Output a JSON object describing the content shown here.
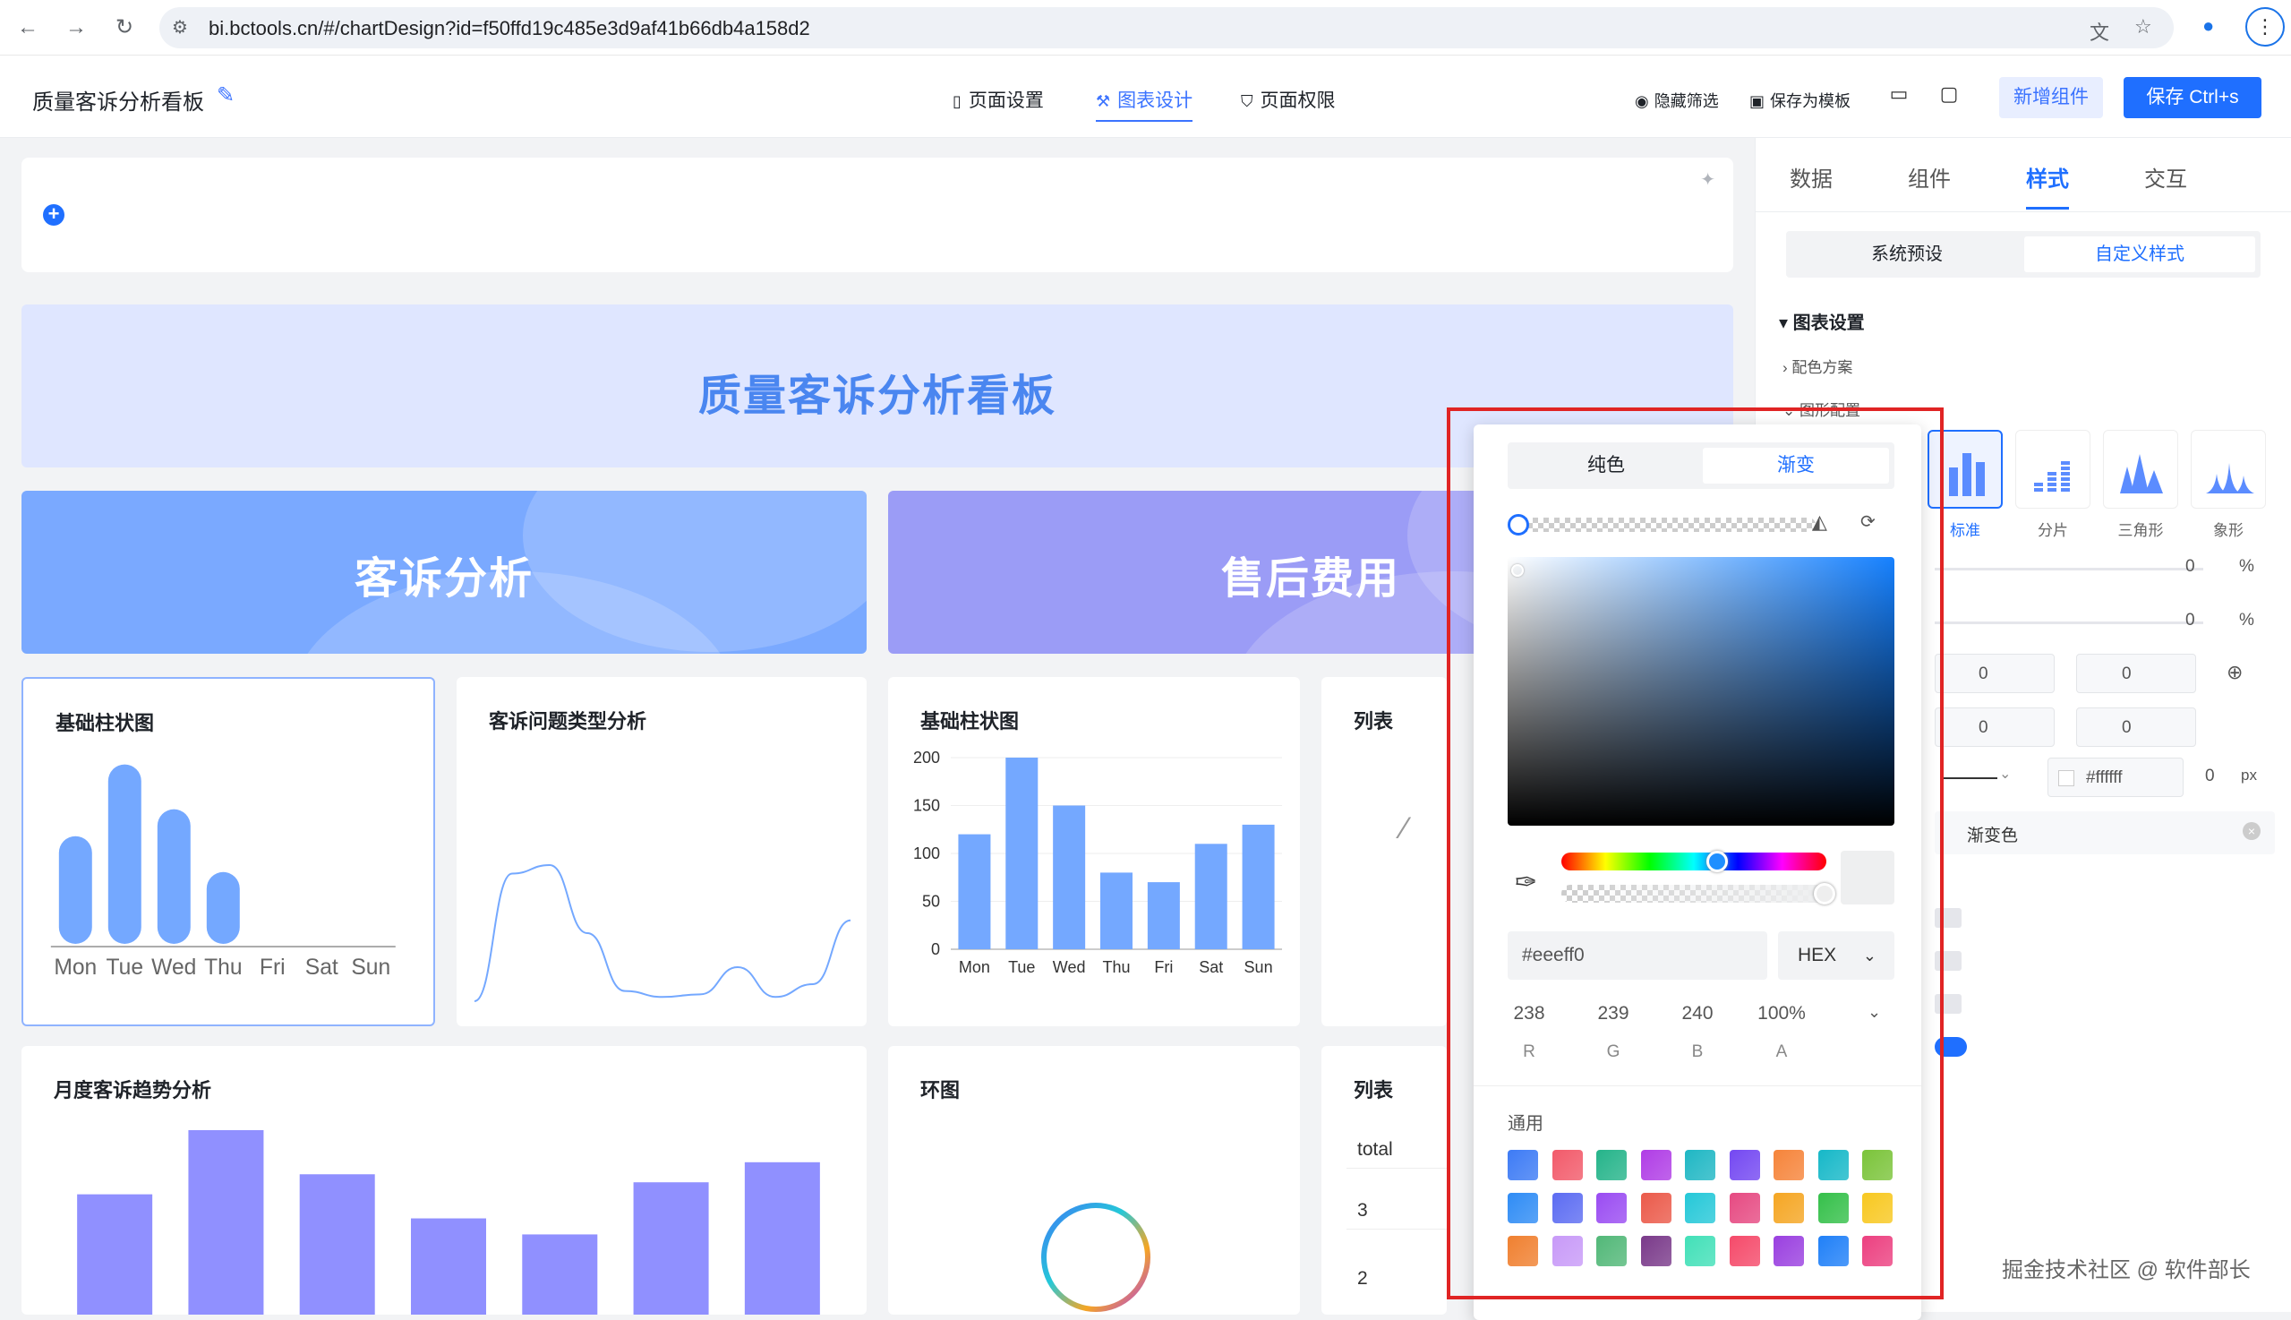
{
  "browser": {
    "url": "bi.bctools.cn/#/chartDesign?id=f50ffd19c485e3d9af41b66db4a158d2"
  },
  "header": {
    "title": "质量客诉分析看板",
    "tabs": [
      {
        "label": "页面设置"
      },
      {
        "label": "图表设计"
      },
      {
        "label": "页面权限"
      }
    ],
    "hide_filter": "隐藏筛选",
    "save_template": "保存为模板",
    "add_component": "新增组件",
    "save": "保存 Ctrl+s"
  },
  "canvas": {
    "banner_title": "质量客诉分析看板",
    "sections": [
      "客诉分析",
      "售后费用"
    ],
    "cards": {
      "c1_title": "基础柱状图",
      "c2_title": "客诉问题类型分析",
      "c3_title": "基础柱状图",
      "c4_title": "列表",
      "c5_title": "月度客诉趋势分析",
      "c6_title": "环图",
      "c7_title": "列表",
      "c7_rows": [
        "total",
        "3",
        "2"
      ]
    }
  },
  "chart_data": [
    {
      "type": "bar",
      "title": "基础柱状图",
      "categories": [
        "Mon",
        "Tue",
        "Wed",
        "Thu",
        "Fri",
        "Sat",
        "Sun"
      ],
      "values": [
        120,
        200,
        150,
        80,
        0,
        0,
        0
      ],
      "grid": false,
      "color": "#74a8ff"
    },
    {
      "type": "line",
      "title": "客诉问题类型分析",
      "x": [
        0,
        1,
        2,
        3,
        4,
        5,
        6,
        7,
        8,
        9,
        10
      ],
      "values": [
        0,
        150,
        160,
        80,
        12,
        5,
        8,
        40,
        5,
        20,
        95
      ],
      "color": "#74a8ff"
    },
    {
      "type": "bar",
      "title": "基础柱状图",
      "categories": [
        "Mon",
        "Tue",
        "Wed",
        "Thu",
        "Fri",
        "Sat",
        "Sun"
      ],
      "values": [
        120,
        200,
        150,
        80,
        70,
        110,
        130
      ],
      "ylim": [
        0,
        200
      ],
      "yticks": [
        0,
        50,
        100,
        150,
        200
      ],
      "grid": true,
      "color": "#74a8ff"
    },
    {
      "type": "bar",
      "title": "月度客诉趋势分析",
      "values": [
        150,
        230,
        175,
        120,
        100,
        165,
        190
      ],
      "color": "#9090ff"
    }
  ],
  "panel": {
    "tabs": [
      "数据",
      "组件",
      "样式",
      "交互"
    ],
    "segments": [
      "系统预设",
      "自定义样式"
    ],
    "chart_settings": "图表设置",
    "color_scheme": "配色方案",
    "shape_config": "图形配置",
    "shape_options": [
      "标准",
      "分片",
      "三角形",
      "象形"
    ],
    "pct1": "0",
    "pct2": "0",
    "pct_unit": "%",
    "radius": [
      "0",
      "0",
      "0",
      "0"
    ],
    "border_color": "#ffffff",
    "border_width": "0",
    "px_unit": "px",
    "gradient_label": "渐变色"
  },
  "picker": {
    "tabs": [
      "纯色",
      "渐变"
    ],
    "hex": "#eeeff0",
    "mode": "HEX",
    "r": "238",
    "g": "239",
    "b": "240",
    "a": "100%",
    "labels": [
      "R",
      "G",
      "B",
      "A"
    ],
    "common_label": "通用",
    "swatches": [
      [
        "#3d7bf5",
        "#f25a6a",
        "#25b48a",
        "#b03de6",
        "#1fb7c4",
        "#7448f2",
        "#f6843a",
        "#16b8c8",
        "#7bc43a"
      ],
      [
        "#2f8cf5",
        "#5c6cf2",
        "#9a4cf2",
        "#eb5a4a",
        "#25c8d8",
        "#e64a82",
        "#f5a623",
        "#35c04a",
        "#f8c820"
      ],
      [
        "#f08030",
        "#c89af8",
        "#52b878",
        "#7a3a8a",
        "#42e0b8",
        "#f54a6a",
        "#9a40e0",
        "#2080f8",
        "#ec4080"
      ]
    ]
  },
  "watermark": "掘金技术社区 @ 软件部长"
}
